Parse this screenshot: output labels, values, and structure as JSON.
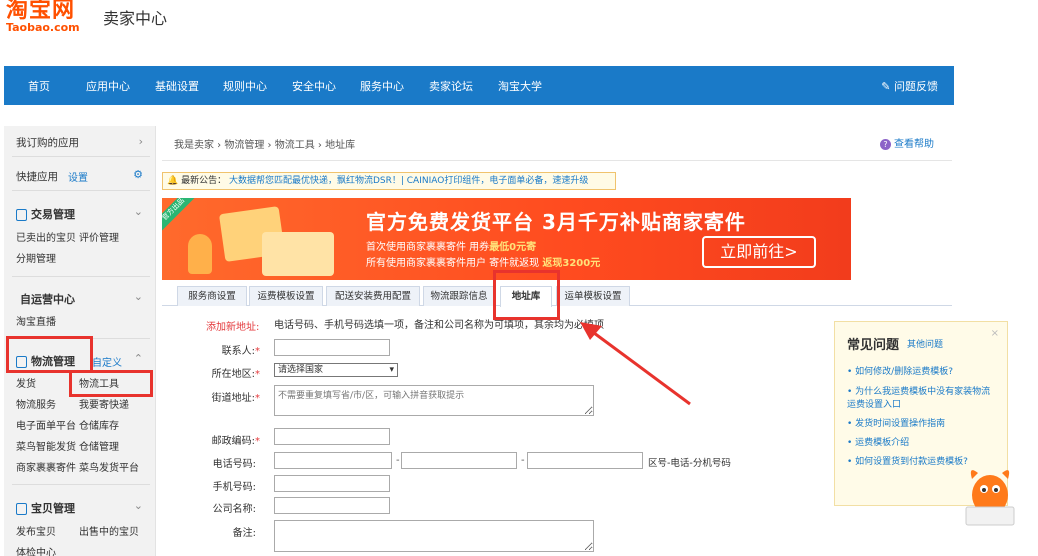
{
  "header": {
    "logo_cn": "淘宝网",
    "logo_en": "Taobao.com",
    "title": "卖家中心"
  },
  "nav": {
    "items": [
      "首页",
      "应用中心",
      "基础设置",
      "规则中心",
      "安全中心",
      "服务中心",
      "卖家论坛",
      "淘宝大学"
    ],
    "feedback": "问题反馈"
  },
  "sidebar": {
    "my_apps": "我订购的应用",
    "quick_apps": "快捷应用",
    "quick_settings": "设置",
    "trade": {
      "heading": "交易管理",
      "links": [
        "已卖出的宝贝",
        "评价管理",
        "分期管理"
      ]
    },
    "self_run": {
      "heading": "自运营中心",
      "links": [
        "淘宝直播"
      ]
    },
    "logistics": {
      "heading": "物流管理",
      "customize": "自定义",
      "links": [
        "发货",
        "物流工具",
        "物流服务",
        "我要寄快递",
        "电子面单平台",
        "仓储库存",
        "菜鸟智能发货",
        "仓储管理",
        "商家裹裹寄件",
        "菜鸟发货平台"
      ]
    },
    "item": {
      "heading": "宝贝管理",
      "links": [
        "发布宝贝",
        "出售中的宝贝",
        "体检中心"
      ]
    }
  },
  "breadcrumb": {
    "items": [
      "我是卖家",
      "物流管理",
      "物流工具",
      "地址库"
    ],
    "help": "查看帮助"
  },
  "notice": {
    "label": "最新公告：",
    "text": "大数据帮您匹配最优快递，飘红物流DSR！| CAINIAO打印组件，电子面单必备，速速升级"
  },
  "banner": {
    "ribbon": "官方出品",
    "headline": "官方免费发货平台 3月千万补贴商家寄件",
    "line2_a": "首次使用商家裹裹寄件 用券",
    "line2_b": "最低0元寄",
    "line3_a": "所有使用商家裹裹寄件用户 寄件就返现",
    "line3_b": "返现3200元",
    "cta": "立即前往>"
  },
  "tabs": [
    "服务商设置",
    "运费模板设置",
    "物流跟踪信息",
    "物流跟踪信息",
    "地址库",
    "运单模板设置"
  ],
  "tabs_visible": [
    "服务商设置",
    "运费模板设置",
    "配送安装费用配置",
    "物流跟踪信息",
    "地址库",
    "运单模板设置"
  ],
  "form": {
    "add_label": "添加新地址:",
    "hint": "电话号码、手机号码选填一项，备注和公司名称为可填项，其余均为必填项",
    "contact": "联系人:",
    "region": "所在地区:",
    "region_value": "请选择国家",
    "street": "街道地址:",
    "street_placeholder": "不需要重复填写省/市/区，可输入拼音获取提示",
    "zip": "邮政编码:",
    "phone": "电话号码:",
    "phone_hint": "区号-电话-分机号码",
    "mobile": "手机号码:",
    "company": "公司名称:",
    "remark": "备注:"
  },
  "faq": {
    "title": "常见问题",
    "more": "其他问题",
    "items": [
      "如何修改/删除运费模板?",
      "为什么我运费模板中没有家装物流运费设置入口",
      "发货时间设置操作指南",
      "运费模板介绍",
      "如何设置货到付款运费模板?"
    ]
  },
  "colors": {
    "brand_orange": "#ff5000",
    "nav_blue": "#1a7ac8",
    "annotation_red": "#e8332d"
  }
}
